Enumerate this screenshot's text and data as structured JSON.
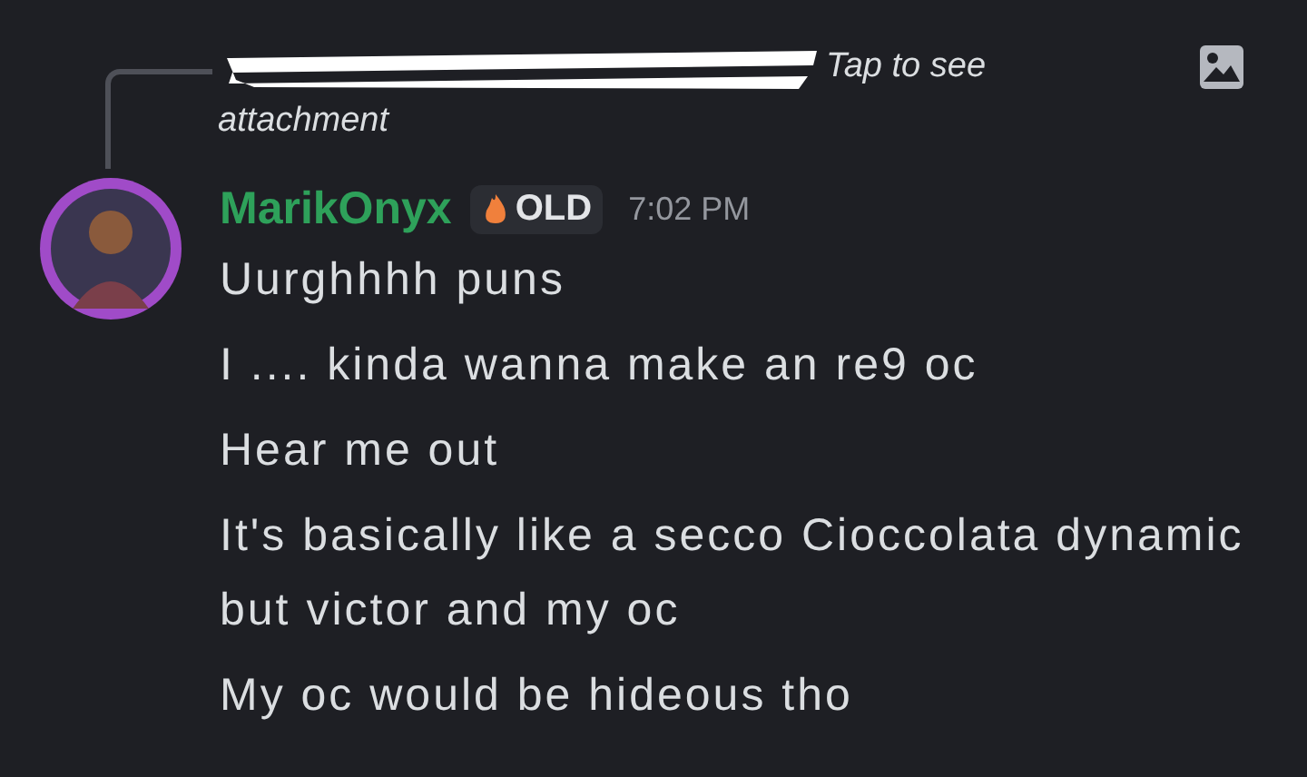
{
  "reply": {
    "lines": [
      "Tap to see",
      "attachment"
    ]
  },
  "message": {
    "author": "MarikOnyx",
    "badge": "OLD",
    "time": "7:02 PM",
    "lines": [
      "Uurghhhh puns",
      "I .... kinda wanna make an re9 oc",
      "Hear me out",
      "It's basically like a secco Cioccolata dynamic but victor and my oc",
      "My oc would be hideous tho"
    ]
  }
}
